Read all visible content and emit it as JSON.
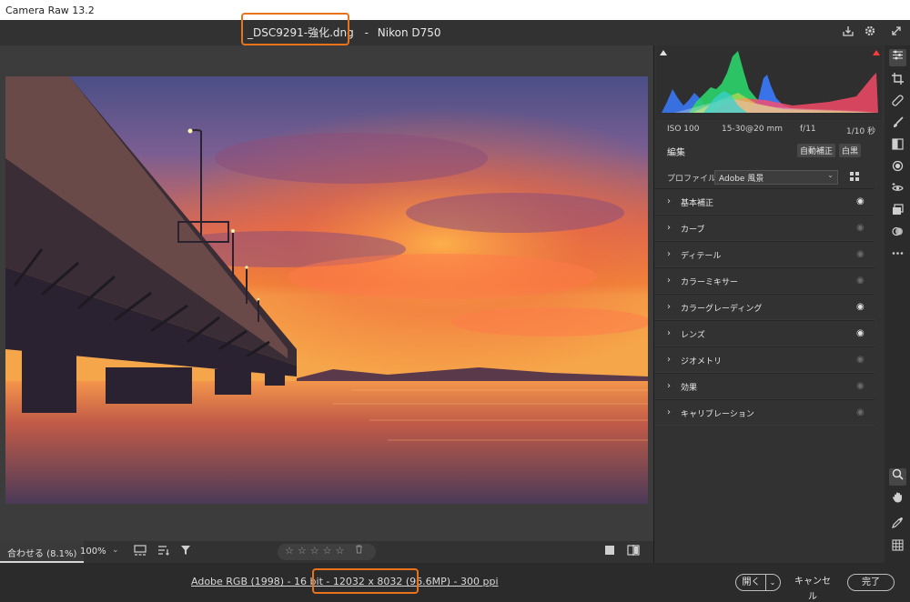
{
  "window": {
    "title": "Camera Raw 13.2"
  },
  "header": {
    "file_name": "_DSC9291-強化.dng",
    "separator": "-",
    "camera": "Nikon D750",
    "icons": [
      "save-icon",
      "settings-gear-icon",
      "fullscreen-icon"
    ]
  },
  "histogram": {
    "colors": {
      "red": "#ff4b6a",
      "green": "#2bd46a",
      "blue": "#3a7bff",
      "cyan": "#39d0d0",
      "yellow": "#e8e44a",
      "white": "#e0e0e0"
    },
    "clip_shadow_icon": "shadow-clip-icon",
    "clip_highlight_icon": "highlight-clip-icon"
  },
  "exif": {
    "iso": "ISO 100",
    "lens": "15-30@20 mm",
    "aperture": "f/11",
    "shutter": "1/10 秒"
  },
  "edit": {
    "title": "編集",
    "auto_label": "自動補正",
    "bw_label": "白黒",
    "profile_label": "プロファイル",
    "profile_value": "Adobe 風景"
  },
  "sections": [
    {
      "label": "基本補正",
      "eye": "on"
    },
    {
      "label": "カーブ",
      "eye": "off"
    },
    {
      "label": "ディテール",
      "eye": "off"
    },
    {
      "label": "カラーミキサー",
      "eye": "off"
    },
    {
      "label": "カラーグレーディング",
      "eye": "on"
    },
    {
      "label": "レンズ",
      "eye": "on"
    },
    {
      "label": "ジオメトリ",
      "eye": "off"
    },
    {
      "label": "効果",
      "eye": "off"
    },
    {
      "label": "キャリブレーション",
      "eye": "off"
    }
  ],
  "image_toolbar": {
    "fit_label": "合わせる (8.1%)",
    "zoom_label": "100%",
    "stars": [
      "☆",
      "☆",
      "☆",
      "☆",
      "☆"
    ],
    "trash_icon": "trash-icon"
  },
  "footer": {
    "info_prefix": "Adobe RGB (1998) - 16 bit - ",
    "dimensions": "12032 x 8032 (96.6MP)",
    "info_suffix": " - 300 ppi",
    "open_label": "開く",
    "cancel_label": "キャンセル",
    "done_label": "完了"
  },
  "accent_color": "#e8731a",
  "tools": [
    "edit-sliders-icon",
    "crop-icon",
    "healing-icon",
    "brush-icon",
    "linear-gradient-icon",
    "radial-filter-icon",
    "red-eye-icon",
    "snapshots-icon",
    "presets-icon",
    "more-icon",
    "zoom-icon",
    "hand-icon",
    "color-sampler-icon",
    "grid-overlay-icon"
  ]
}
